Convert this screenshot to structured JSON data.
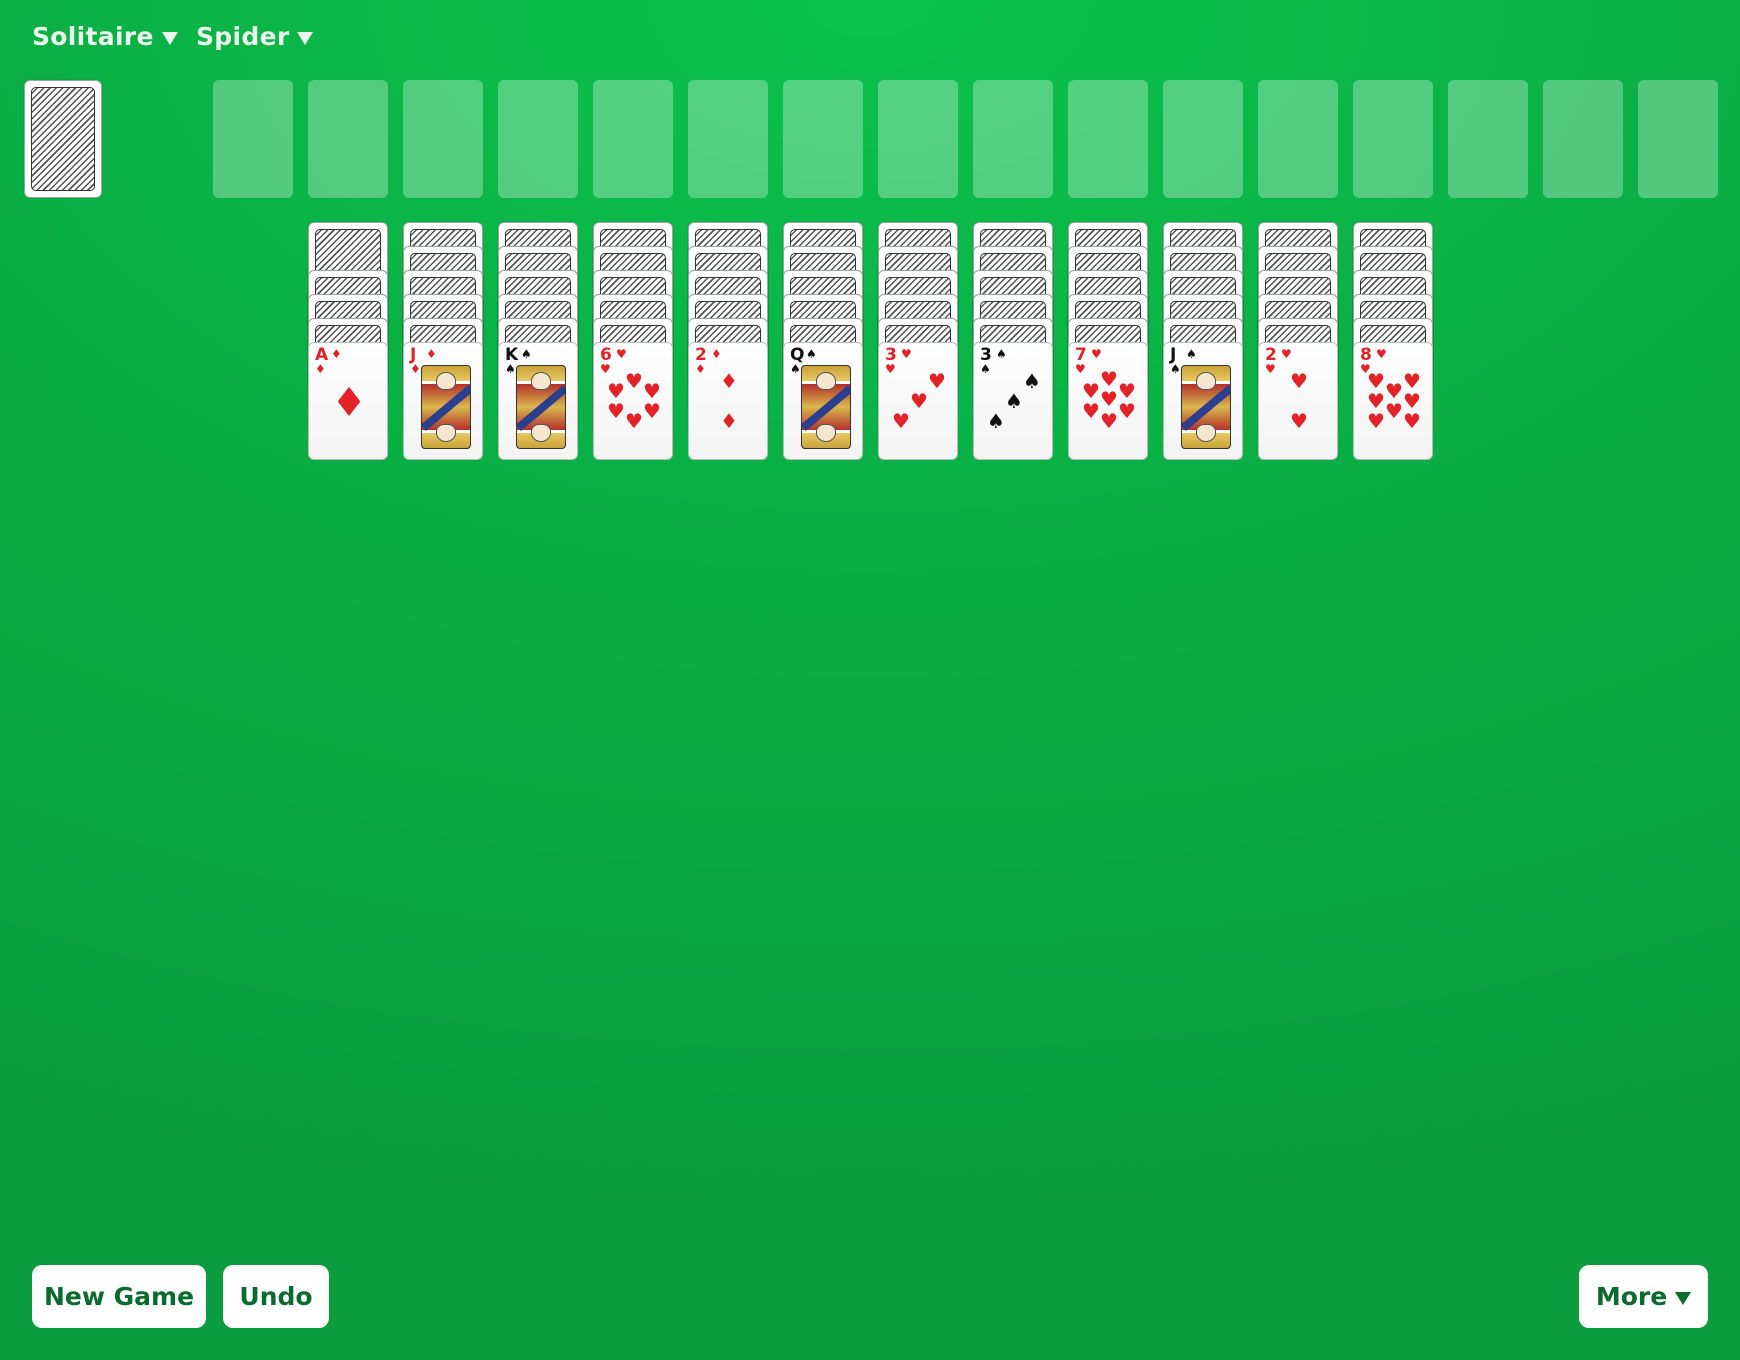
{
  "menus": {
    "game_type": {
      "label": "Solitaire"
    },
    "variant": {
      "label": "Spider"
    }
  },
  "icons": {
    "dropdown": "caret-down-icon",
    "card_back": "card-back-icon"
  },
  "colors": {
    "felt": "#0aae44",
    "red_suit": "#e32228",
    "black_suit": "#111111",
    "button_text": "#0b6b2e"
  },
  "stock": {
    "face_down": true,
    "count_visible": 1
  },
  "foundations": {
    "count": 16,
    "filled": 0
  },
  "tableau": [
    {
      "face_down": 4,
      "top": {
        "rank": "A",
        "suit": "♦",
        "color": "red"
      }
    },
    {
      "face_down": 5,
      "top": {
        "rank": "J",
        "suit": "♦",
        "color": "red"
      }
    },
    {
      "face_down": 5,
      "top": {
        "rank": "K",
        "suit": "♠",
        "color": "black"
      }
    },
    {
      "face_down": 5,
      "top": {
        "rank": "6",
        "suit": "♥",
        "color": "red"
      }
    },
    {
      "face_down": 5,
      "top": {
        "rank": "2",
        "suit": "♦",
        "color": "red"
      }
    },
    {
      "face_down": 5,
      "top": {
        "rank": "Q",
        "suit": "♠",
        "color": "black"
      }
    },
    {
      "face_down": 5,
      "top": {
        "rank": "3",
        "suit": "♥",
        "color": "red"
      }
    },
    {
      "face_down": 5,
      "top": {
        "rank": "3",
        "suit": "♠",
        "color": "black"
      }
    },
    {
      "face_down": 5,
      "top": {
        "rank": "7",
        "suit": "♥",
        "color": "red"
      }
    },
    {
      "face_down": 5,
      "top": {
        "rank": "J",
        "suit": "♠",
        "color": "black"
      }
    },
    {
      "face_down": 5,
      "top": {
        "rank": "2",
        "suit": "♥",
        "color": "red"
      }
    },
    {
      "face_down": 5,
      "top": {
        "rank": "8",
        "suit": "♥",
        "color": "red"
      }
    }
  ],
  "buttons": {
    "new_game": "New Game",
    "undo": "Undo",
    "more": "More"
  }
}
